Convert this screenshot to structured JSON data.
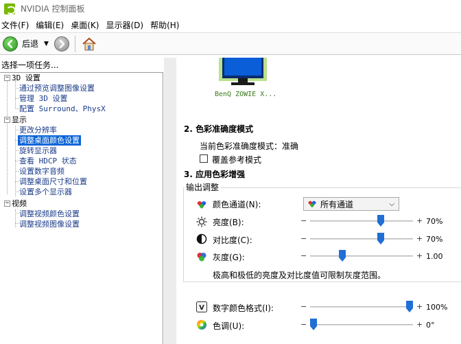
{
  "window": {
    "title": "NVIDIA 控制面板"
  },
  "menu": [
    {
      "label": "文件(F)"
    },
    {
      "label": "编辑(E)"
    },
    {
      "label": "桌面(K)"
    },
    {
      "label": "显示器(D)"
    },
    {
      "label": "帮助(H)"
    }
  ],
  "toolbar": {
    "back_label": "后退",
    "back_icon": "arrow-left-icon",
    "forward_icon": "arrow-right-icon",
    "home_icon": "home-icon"
  },
  "tasks": {
    "header": "选择一项任务...",
    "categories": [
      {
        "label": "3D 设置",
        "expander": "−",
        "items": [
          "通过预览调整图像设置",
          "管理 3D 设置",
          "配置 Surround、PhysX"
        ]
      },
      {
        "label": "显示",
        "expander": "−",
        "items": [
          "更改分辨率",
          "调整桌面颜色设置",
          "旋转显示器",
          "查看 HDCP 状态",
          "设置数字音频",
          "调整桌面尺寸和位置",
          "设置多个显示器"
        ]
      },
      {
        "label": "视频",
        "expander": "−",
        "items": [
          "调整视频颜色设置",
          "调整视频图像设置"
        ]
      }
    ],
    "selected": "调整桌面颜色设置"
  },
  "content": {
    "monitor_label": "BenQ ZOWIE X...",
    "section2": {
      "title": "2. 色彩准确度模式",
      "current_mode_label": "当前色彩准确度模式：",
      "current_mode_value": "准确",
      "override_label": "覆盖参考模式",
      "override_checked": false
    },
    "section3": {
      "title": "3. 应用色彩增强",
      "group_label": "输出调整",
      "channel": {
        "label": "颜色通道(N):",
        "selected": "所有通道"
      },
      "sliders": [
        {
          "label": "亮度(B):",
          "icon": "sun-icon",
          "value_text": "70%",
          "fraction": 0.7
        },
        {
          "label": "对比度(C):",
          "icon": "contrast-icon",
          "value_text": "70%",
          "fraction": 0.7
        },
        {
          "label": "灰度(G):",
          "icon": "gamma-icon",
          "value_text": "1.00",
          "fraction": 0.3
        }
      ],
      "note": "极高和极低的亮度及对比度值可限制灰度范围。",
      "vibrance": {
        "label": "数字颜色格式(I):",
        "icon": "vibrance-icon",
        "value_text": "100%",
        "fraction": 1.0
      },
      "hue": {
        "label": "色调(U):",
        "icon": "hue-icon",
        "value_text": "0°",
        "fraction": 0.0
      },
      "minus": "−",
      "plus": "+"
    }
  },
  "colors": {
    "selection": "#0a64d8",
    "link": "#1a3b8a",
    "nvidia_green": "#76b900",
    "slider_thumb": "#1f6fd6"
  }
}
